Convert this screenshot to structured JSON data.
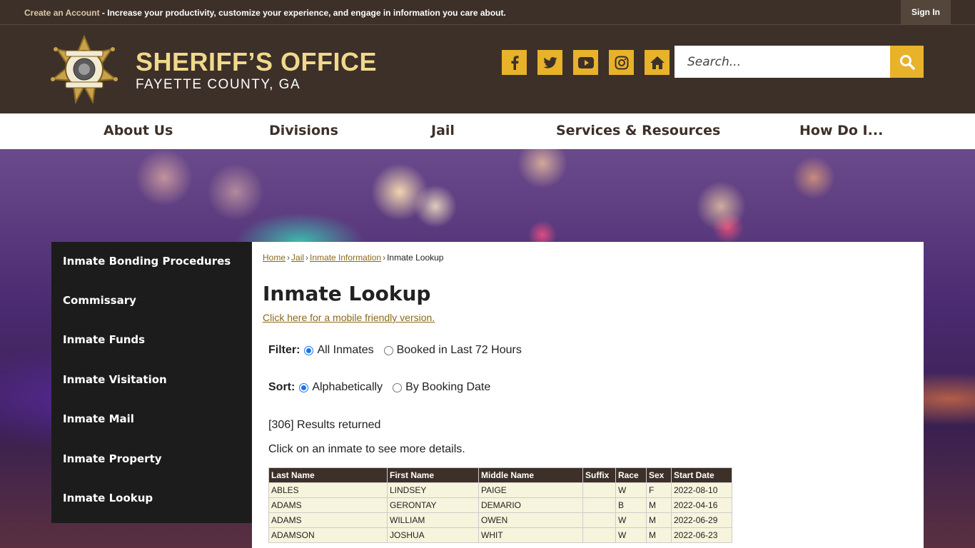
{
  "topbar": {
    "create_account": "Create an Account",
    "message": " - Increase your productivity, customize your experience, and engage in information you care about.",
    "sign_in": "Sign In"
  },
  "header": {
    "title": "SHERIFF’S OFFICE",
    "subtitle": "FAYETTE COUNTY, GA",
    "search_placeholder": "Search...",
    "accent_color": "#e8b22a",
    "social_icons": [
      "facebook-icon",
      "twitter-icon",
      "youtube-icon",
      "instagram-icon",
      "home-icon"
    ]
  },
  "nav": {
    "items": [
      "About Us",
      "Divisions",
      "Jail",
      "Services & Resources",
      "How Do I..."
    ]
  },
  "sidebar": {
    "items": [
      "Inmate Bonding Procedures",
      "Commissary",
      "Inmate Funds",
      "Inmate Visitation",
      "Inmate Mail",
      "Inmate Property",
      "Inmate Lookup"
    ]
  },
  "breadcrumb": {
    "home": "Home",
    "jail": "Jail",
    "info": "Inmate Information",
    "current": "Inmate Lookup"
  },
  "main": {
    "title": "Inmate Lookup",
    "mobile_link": "Click here for a mobile friendly version.",
    "filter_label": "Filter:",
    "filter_options": [
      "All Inmates",
      "Booked in Last 72 Hours"
    ],
    "sort_label": "Sort:",
    "sort_options": [
      "Alphabetically",
      "By Booking Date"
    ],
    "results": "[306] Results returned",
    "instructions": "Click on an inmate to see more details."
  },
  "table": {
    "headers": [
      "Last Name",
      "First Name",
      "Middle Name",
      "Suffix",
      "Race",
      "Sex",
      "Start Date"
    ],
    "rows": [
      [
        "ABLES",
        "LINDSEY",
        "PAIGE",
        "",
        "W",
        "F",
        "2022-08-10"
      ],
      [
        "ADAMS",
        "GERONTAY",
        "DEMARIO",
        "",
        "B",
        "M",
        "2022-04-16"
      ],
      [
        "ADAMS",
        "WILLIAM",
        "OWEN",
        "",
        "W",
        "M",
        "2022-06-29"
      ],
      [
        "ADAMSON",
        "JOSHUA",
        "WHIT",
        "",
        "W",
        "M",
        "2022-06-23"
      ]
    ]
  }
}
